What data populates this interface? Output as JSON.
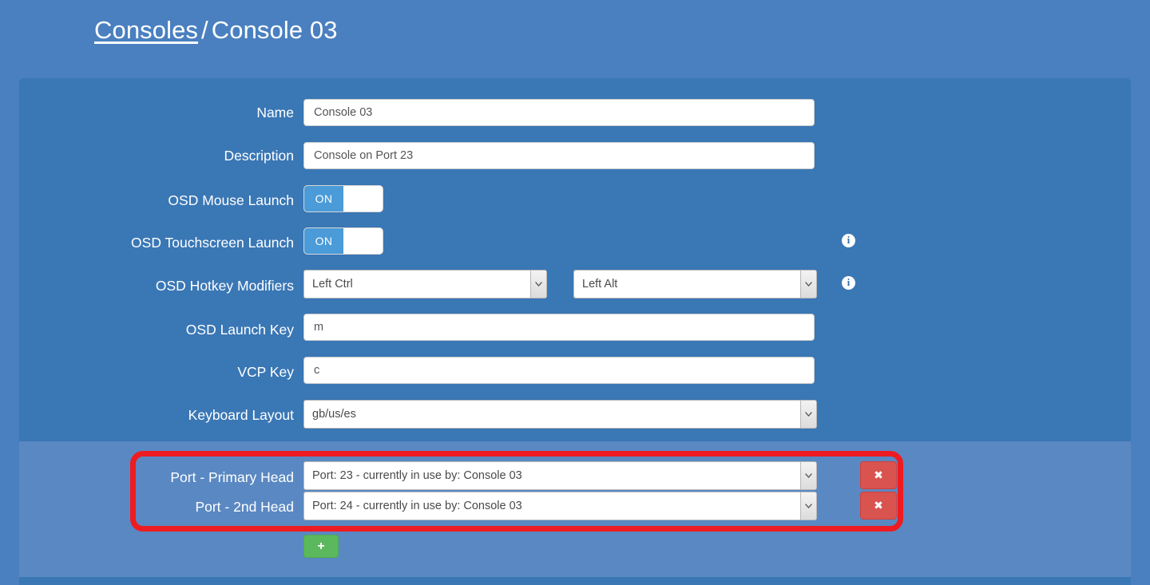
{
  "breadcrumb": {
    "parent": "Consoles",
    "separator": "/",
    "current": "Console 03"
  },
  "form": {
    "fields": {
      "name": {
        "label": "Name",
        "value": "Console 03"
      },
      "description": {
        "label": "Description",
        "value": "Console on Port 23"
      },
      "osd_mouse_launch": {
        "label": "OSD Mouse Launch",
        "state": "ON"
      },
      "osd_touchscreen_launch": {
        "label": "OSD Touchscreen Launch",
        "state": "ON"
      },
      "osd_hotkey_modifiers": {
        "label": "OSD Hotkey Modifiers",
        "modifier_1": "Left Ctrl",
        "modifier_2": "Left Alt"
      },
      "osd_launch_key": {
        "label": "OSD Launch Key",
        "value": "m"
      },
      "vcp_key": {
        "label": "VCP Key",
        "value": "c"
      },
      "keyboard_layout": {
        "label": "Keyboard Layout",
        "value": "gb/us/es"
      }
    }
  },
  "ports": {
    "rows": [
      {
        "label": "Port - Primary Head",
        "value": "Port: 23 - currently in use by: Console 03",
        "remove_label": "✖"
      },
      {
        "label": "Port - 2nd Head",
        "value": "Port: 24 - currently in use by: Console 03",
        "remove_label": "✖"
      }
    ],
    "add_label": "+"
  },
  "icons": {
    "info": "i"
  },
  "colors": {
    "page_background": "#4a80c0",
    "card_background": "#3a77b5",
    "ports_panel_background": "#5a88c2",
    "annotation_border": "#ee1c22",
    "toggle_on": "#4a9bd8",
    "remove_button": "#d9534f",
    "add_button": "#5cb85c"
  }
}
